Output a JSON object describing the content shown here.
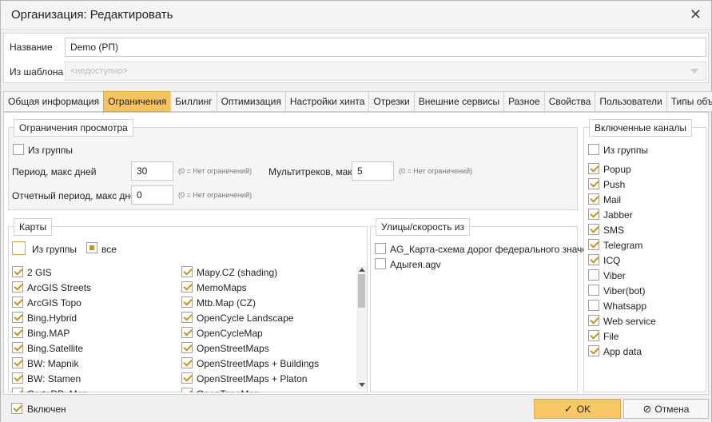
{
  "window": {
    "title": "Организация: Редактировать"
  },
  "form": {
    "name_label": "Название",
    "name_value": "Demo (РП)",
    "template_label": "Из шаблона",
    "template_value": "<недоступно>"
  },
  "tabs": [
    {
      "label": "Общая информация",
      "active": false
    },
    {
      "label": "Ограничения",
      "active": true
    },
    {
      "label": "Биллинг",
      "active": false
    },
    {
      "label": "Оптимизация",
      "active": false
    },
    {
      "label": "Настройки хинта",
      "active": false
    },
    {
      "label": "Отрезки",
      "active": false
    },
    {
      "label": "Внешние сервисы",
      "active": false
    },
    {
      "label": "Разное",
      "active": false
    },
    {
      "label": "Свойства",
      "active": false
    },
    {
      "label": "Пользователи",
      "active": false
    },
    {
      "label": "Типы объектов",
      "active": false
    }
  ],
  "view_limits": {
    "legend": "Ограничения просмотра",
    "from_group_label": "Из группы",
    "period_label": "Период, макс дней",
    "period_value": "30",
    "period_hint": "(0 = Нет ограничений)",
    "multitrack_label": "Мультитреков, макс",
    "multitrack_value": "5",
    "multitrack_hint": "(0 = Нет ограничений)",
    "report_label": "Отчетный период, макс дней",
    "report_value": "0",
    "report_hint": "(0 = Нет ограничений)"
  },
  "maps": {
    "legend": "Карты",
    "from_group_label": "Из группы",
    "all_label": "все",
    "col1": [
      "2 GIS",
      "ArcGIS Streets",
      "ArcGIS Topo",
      "Bing.Hybrid",
      "Bing.MAP",
      "Bing.Satellite",
      "BW: Mapnik",
      "BW: Stamen",
      "CartoDB: Map"
    ],
    "col2": [
      "Mapy.CZ (shading)",
      "MemoMaps",
      "Mtb.Map (CZ)",
      "OpenCycle Landscape",
      "OpenCycleMap",
      "OpenStreetMaps",
      "OpenStreetMaps + Buildings",
      "OpenStreetMaps + Platon",
      "OpenTopoMap"
    ]
  },
  "streets": {
    "legend": "Улицы/скорость из",
    "items": [
      "AG_Карта-схема дорог федерального значен...",
      "Адыгея.agv"
    ]
  },
  "channels": {
    "legend": "Включенные каналы",
    "from_group_label": "Из группы",
    "items": [
      {
        "label": "Popup",
        "checked": true
      },
      {
        "label": "Push",
        "checked": true
      },
      {
        "label": "Mail",
        "checked": true
      },
      {
        "label": "Jabber",
        "checked": true
      },
      {
        "label": "SMS",
        "checked": true
      },
      {
        "label": "Telegram",
        "checked": true
      },
      {
        "label": "ICQ",
        "checked": true
      },
      {
        "label": "Viber",
        "checked": false
      },
      {
        "label": "Viber(bot)",
        "checked": false
      },
      {
        "label": "Whatsapp",
        "checked": false
      },
      {
        "label": "Web service",
        "checked": true
      },
      {
        "label": "File",
        "checked": true
      },
      {
        "label": "App data",
        "checked": true
      }
    ]
  },
  "footer": {
    "enabled_label": "Включен",
    "ok_label": "OK",
    "cancel_label": "Отмена"
  },
  "colors": {
    "accent": "#f6c35e",
    "check": "#c7941a"
  }
}
